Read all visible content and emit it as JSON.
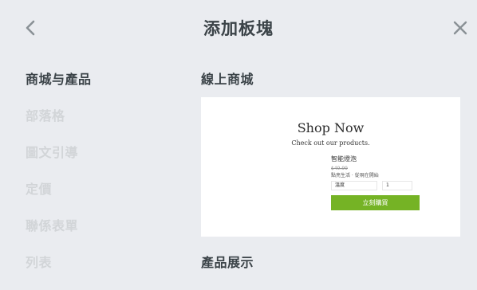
{
  "header": {
    "title": "添加板塊",
    "back_icon": "chevron-left-icon",
    "close_icon": "close-icon"
  },
  "sidebar": {
    "items": [
      {
        "label": "商城与產品",
        "active": true
      },
      {
        "label": "部落格",
        "active": false
      },
      {
        "label": "圖文引導",
        "active": false
      },
      {
        "label": "定價",
        "active": false
      },
      {
        "label": "聯係表單",
        "active": false
      },
      {
        "label": "列表",
        "active": false
      }
    ]
  },
  "main": {
    "sections": [
      {
        "title": "線上商城",
        "preview": {
          "heading": "Shop Now",
          "subheading": "Check out our products.",
          "product_name": "智能燈泡",
          "product_price": "$49.99",
          "product_note": "點亮生活 · 從現在開始",
          "option_label": "溫度",
          "quantity": "1",
          "buy_label": "立刻購買",
          "buy_color": "#75b325"
        }
      },
      {
        "title": "產品展示"
      }
    ]
  },
  "colors": {
    "background": "#eaecf0",
    "text_active": "#3b4348",
    "text_inactive": "#d2d5d8"
  }
}
